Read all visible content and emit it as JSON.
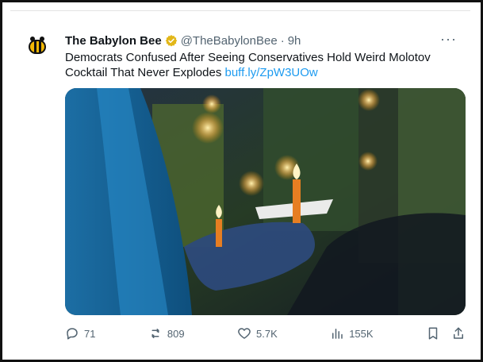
{
  "tweet": {
    "name": "The Babylon Bee",
    "handle": "@TheBabylonBee",
    "separator": "·",
    "time": "9h",
    "more": "···",
    "text_main": "Democrats Confused After Seeing Conservatives Hold Weird Molotov Cocktail That Never Explodes",
    "text_link": "buff.ly/ZpW3UOw"
  },
  "actions": {
    "replies": "71",
    "reposts": "809",
    "likes": "5.7K",
    "views": "155K"
  },
  "icons": {
    "avatar": "bee-logo-icon",
    "verified": "verified-badge-icon",
    "reply": "reply-icon",
    "repost": "repost-icon",
    "like": "heart-icon",
    "views": "views-icon",
    "bookmark": "bookmark-icon",
    "share": "share-icon"
  },
  "colors": {
    "accent": "#1d9bf0",
    "text": "#0f1419",
    "muted": "#536471",
    "badge": "#e2b719"
  }
}
